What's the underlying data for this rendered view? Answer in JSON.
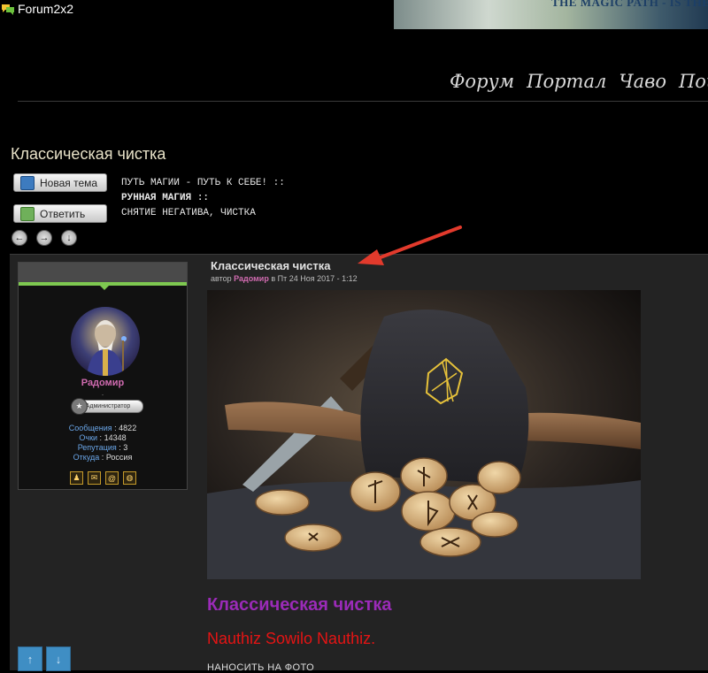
{
  "brand": {
    "name": "Forum2x2"
  },
  "banner": {
    "text": "THE MAGIC PATH - IS THE"
  },
  "topnav": [
    "Форум",
    "Портал",
    "Чаво",
    "Поиск"
  ],
  "page_title": "Классическая чистка",
  "buttons": {
    "new_topic": "Новая тема",
    "reply": "Ответить"
  },
  "breadcrumb": [
    "ПУТЬ МАГИИ - ПУТЬ К СЕБЕ! ::",
    "РУННАЯ МАГИЯ ::",
    "СНЯТИЕ НЕГАТИВА, ЧИСТКА"
  ],
  "nav_arrows": {
    "prev": "←",
    "next": "→",
    "down": "↓"
  },
  "profile": {
    "username": "Радомир",
    "dot": ".",
    "rank": "Администратор",
    "stats": [
      {
        "label": "Сообщения",
        "value": "4822"
      },
      {
        "label": "Очки",
        "value": "14348"
      },
      {
        "label": "Репутация",
        "value": "3"
      },
      {
        "label": "Откуда",
        "value": "Россия"
      }
    ]
  },
  "post": {
    "title": "Классическая чистка",
    "meta_prefix": "автор",
    "author": "Радомир",
    "meta_date": "в Пт 24 Ноя 2017 - 1:12",
    "content_title": "Классическая чистка",
    "content_red": "Nauthiz Sowilo Nauthiz.",
    "content_text": "НАНОСИТЬ НА ФОТО"
  },
  "vote": {
    "up": "↑",
    "down": "↓"
  },
  "colors": {
    "author": "#d06bb0",
    "accent_green": "#7ec850",
    "content_purple": "#9b2bb8",
    "content_red": "#e41414",
    "annotation_arrow": "#e23a2c"
  }
}
